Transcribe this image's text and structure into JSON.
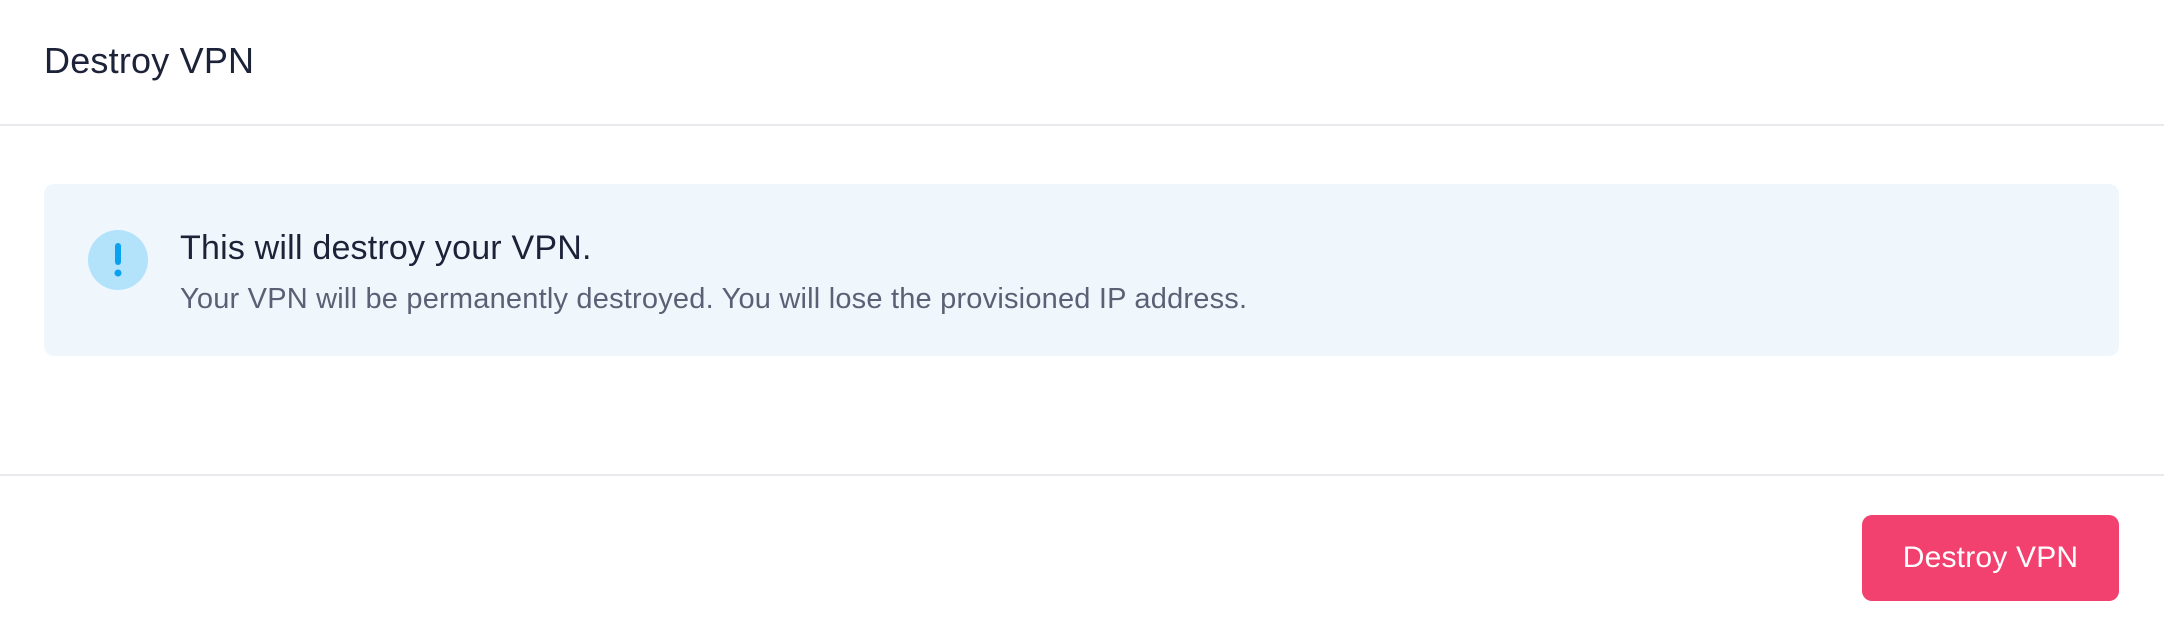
{
  "header": {
    "title": "Destroy VPN"
  },
  "alert": {
    "icon": "exclamation-icon",
    "title": "This will destroy your VPN.",
    "message": "Your VPN will be permanently destroyed. You will lose the provisioned IP address.",
    "colors": {
      "background": "#eff7fd",
      "icon_background": "#b3e2fb",
      "icon_color": "#0aa2f0"
    }
  },
  "footer": {
    "destroy_button_label": "Destroy VPN",
    "destroy_button_color": "#f3416f"
  }
}
